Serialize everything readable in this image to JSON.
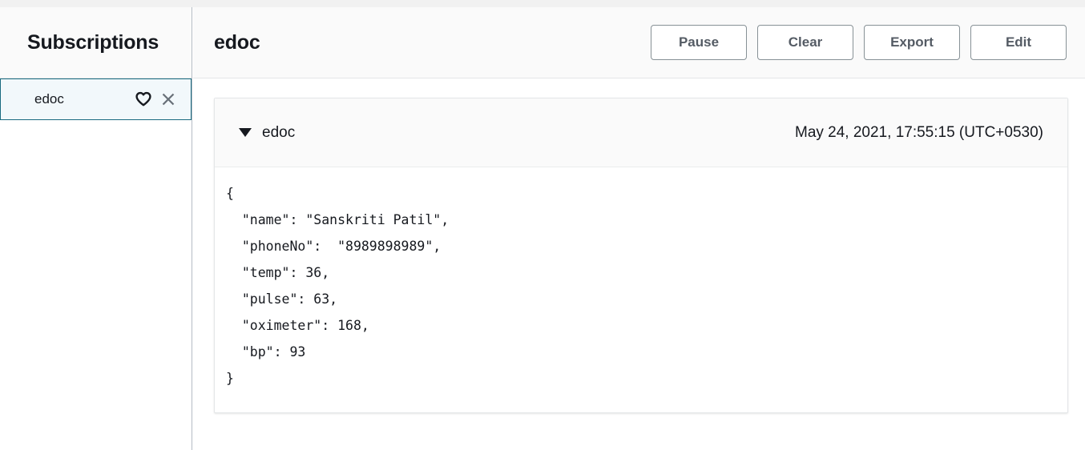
{
  "sidebar": {
    "title": "Subscriptions",
    "items": [
      {
        "label": "edoc",
        "selected": true,
        "favorite_icon": "heart-outline-icon",
        "close_icon": "close-icon"
      }
    ]
  },
  "header": {
    "title": "edoc",
    "buttons": [
      {
        "label": "Pause",
        "name": "pause-button"
      },
      {
        "label": "Clear",
        "name": "clear-button"
      },
      {
        "label": "Export",
        "name": "export-button"
      },
      {
        "label": "Edit",
        "name": "edit-button"
      }
    ]
  },
  "message": {
    "expanded": true,
    "toggle_icon": "caret-down-icon",
    "topic": "edoc",
    "timestamp": "May 24, 2021, 17:55:15 (UTC+0530)",
    "payload": "{\n  \"name\": \"Sanskriti Patil\",\n  \"phoneNo\":  \"8989898989\",\n  \"temp\": 36,\n  \"pulse\": 63,\n  \"oximeter\": 168,\n  \"bp\": 93\n}",
    "payload_fields": {
      "name": "Sanskriti Patil",
      "phoneNo": "8989898989",
      "temp": 36,
      "pulse": 63,
      "oximeter": 168,
      "bp": 93
    }
  },
  "colors": {
    "selected_border": "#1a6b80",
    "selected_background": "#f2f8fb",
    "header_background": "#fafafa",
    "text": "#16191f",
    "button_text": "#545b64",
    "button_border": "#879196"
  }
}
